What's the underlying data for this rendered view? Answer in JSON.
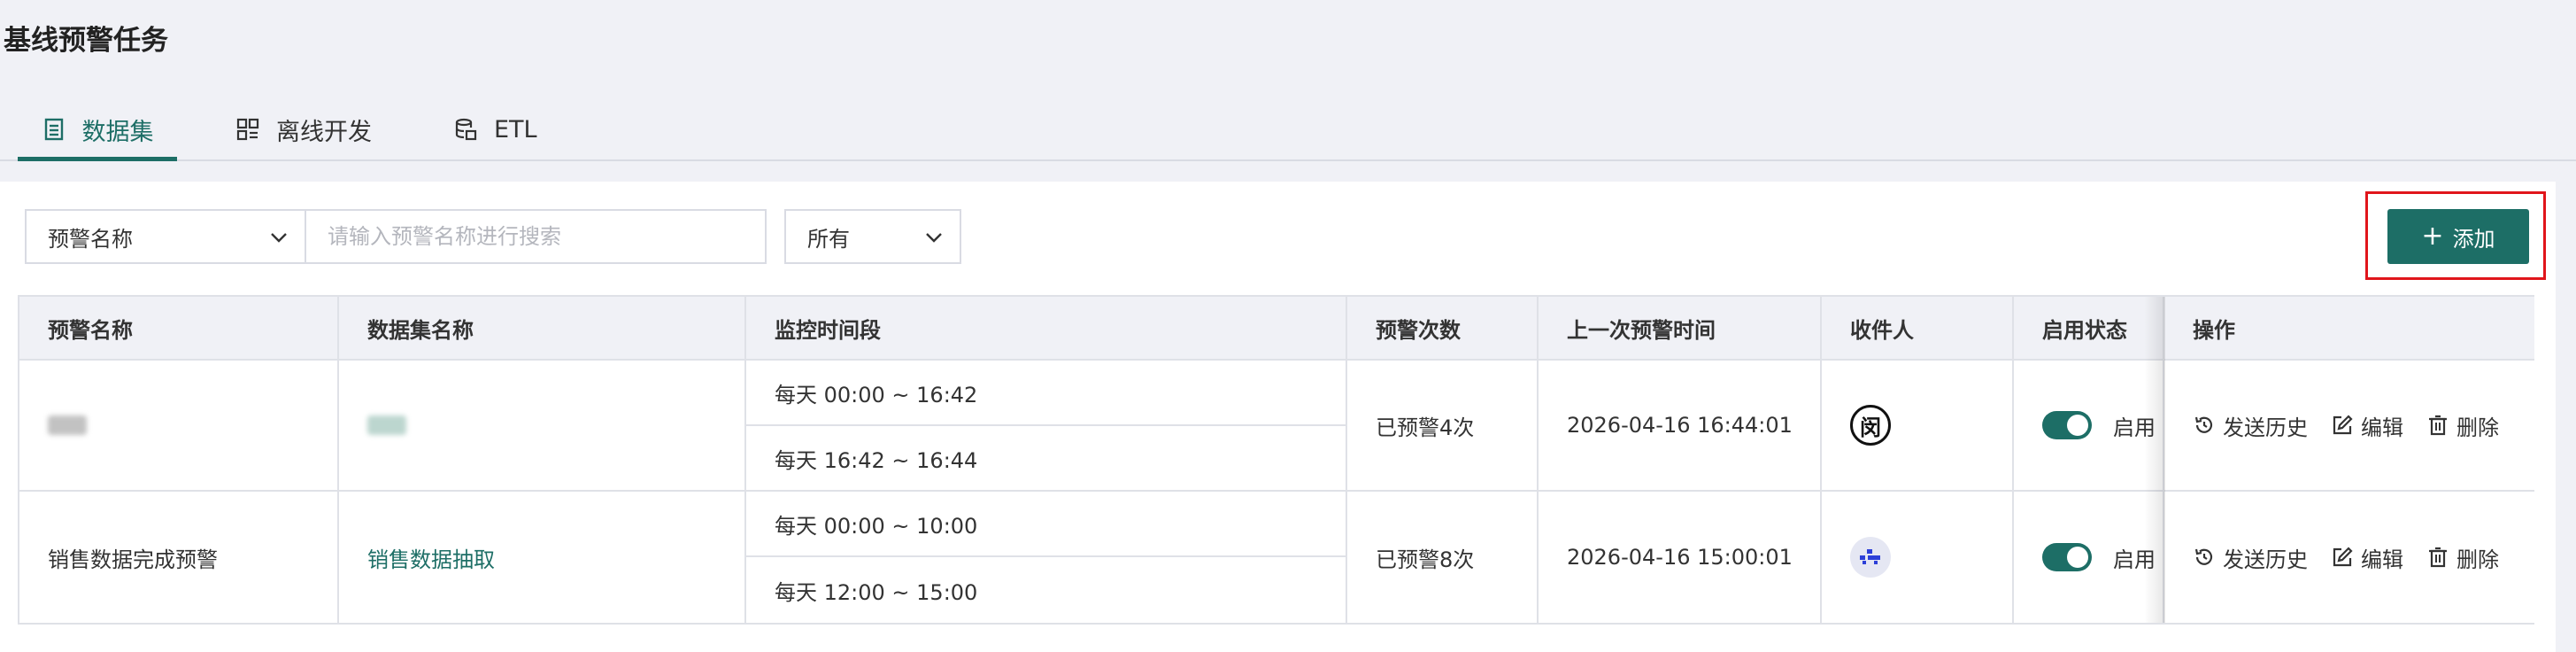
{
  "page": {
    "title": "基线预警任务"
  },
  "tabs": [
    {
      "label": "数据集",
      "icon": "dataset-icon",
      "active": true
    },
    {
      "label": "离线开发",
      "icon": "offline-dev-icon",
      "active": false
    },
    {
      "label": "ETL",
      "icon": "etl-icon",
      "active": false
    }
  ],
  "filters": {
    "field_select": "预警名称",
    "search_placeholder": "请输入预警名称进行搜索",
    "status_select": "所有"
  },
  "actions": {
    "add_label": "添加"
  },
  "table": {
    "columns": [
      "预警名称",
      "数据集名称",
      "监控时间段",
      "预警次数",
      "上一次预警时间",
      "收件人",
      "启用状态",
      "操作"
    ],
    "rows": [
      {
        "name": "",
        "dataset": "",
        "periods": [
          "每天 00:00 ~ 16:42",
          "每天 16:42 ~ 16:44"
        ],
        "count": "已预警4次",
        "last_time": "2026-04-16 16:44:01",
        "recipient_avatar": "闵",
        "enabled": true,
        "status_label": "启用"
      },
      {
        "name": "销售数据完成预警",
        "dataset": "销售数据抽取",
        "periods": [
          "每天 00:00 ~ 10:00",
          "每天 12:00 ~ 15:00"
        ],
        "count": "已预警8次",
        "last_time": "2026-04-16 15:00:01",
        "recipient_avatar": "",
        "enabled": true,
        "status_label": "启用"
      }
    ],
    "ops": {
      "history": "发送历史",
      "edit": "编辑",
      "delete": "删除"
    }
  },
  "colors": {
    "accent": "#1d6e66",
    "highlight": "#e0151b",
    "background": "#f0f1f6"
  }
}
